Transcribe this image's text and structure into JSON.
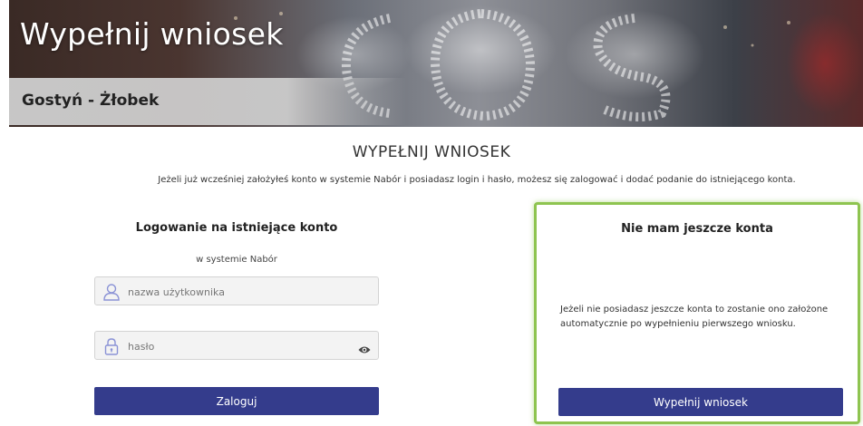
{
  "banner": {
    "title": "Wypełnij wniosek",
    "subtitle": "Gostyń - Żłobek"
  },
  "main": {
    "heading": "WYPEŁNIJ WNIOSEK",
    "intro": "Jeżeli już wcześniej założyłeś konto w systemie Nabór i posiadasz login i hasło, możesz się zalogować i dodać podanie do istniejącego konta."
  },
  "login": {
    "title": "Logowanie na istniejące konto",
    "subtitle": "w systemie Nabór",
    "username_placeholder": "nazwa użytkownika",
    "password_placeholder": "hasło",
    "button_label": "Zaloguj"
  },
  "new_account": {
    "title": "Nie mam jeszcze konta",
    "text": "Jeżeli nie posiadasz jeszcze konta to zostanie ono założone automatycznie po wypełnieniu pierwszego wniosku.",
    "button_label": "Wypełnij wniosek"
  },
  "colors": {
    "button": "#343c8c",
    "panel_border": "#8ec450",
    "icon": "#8b93d6"
  }
}
